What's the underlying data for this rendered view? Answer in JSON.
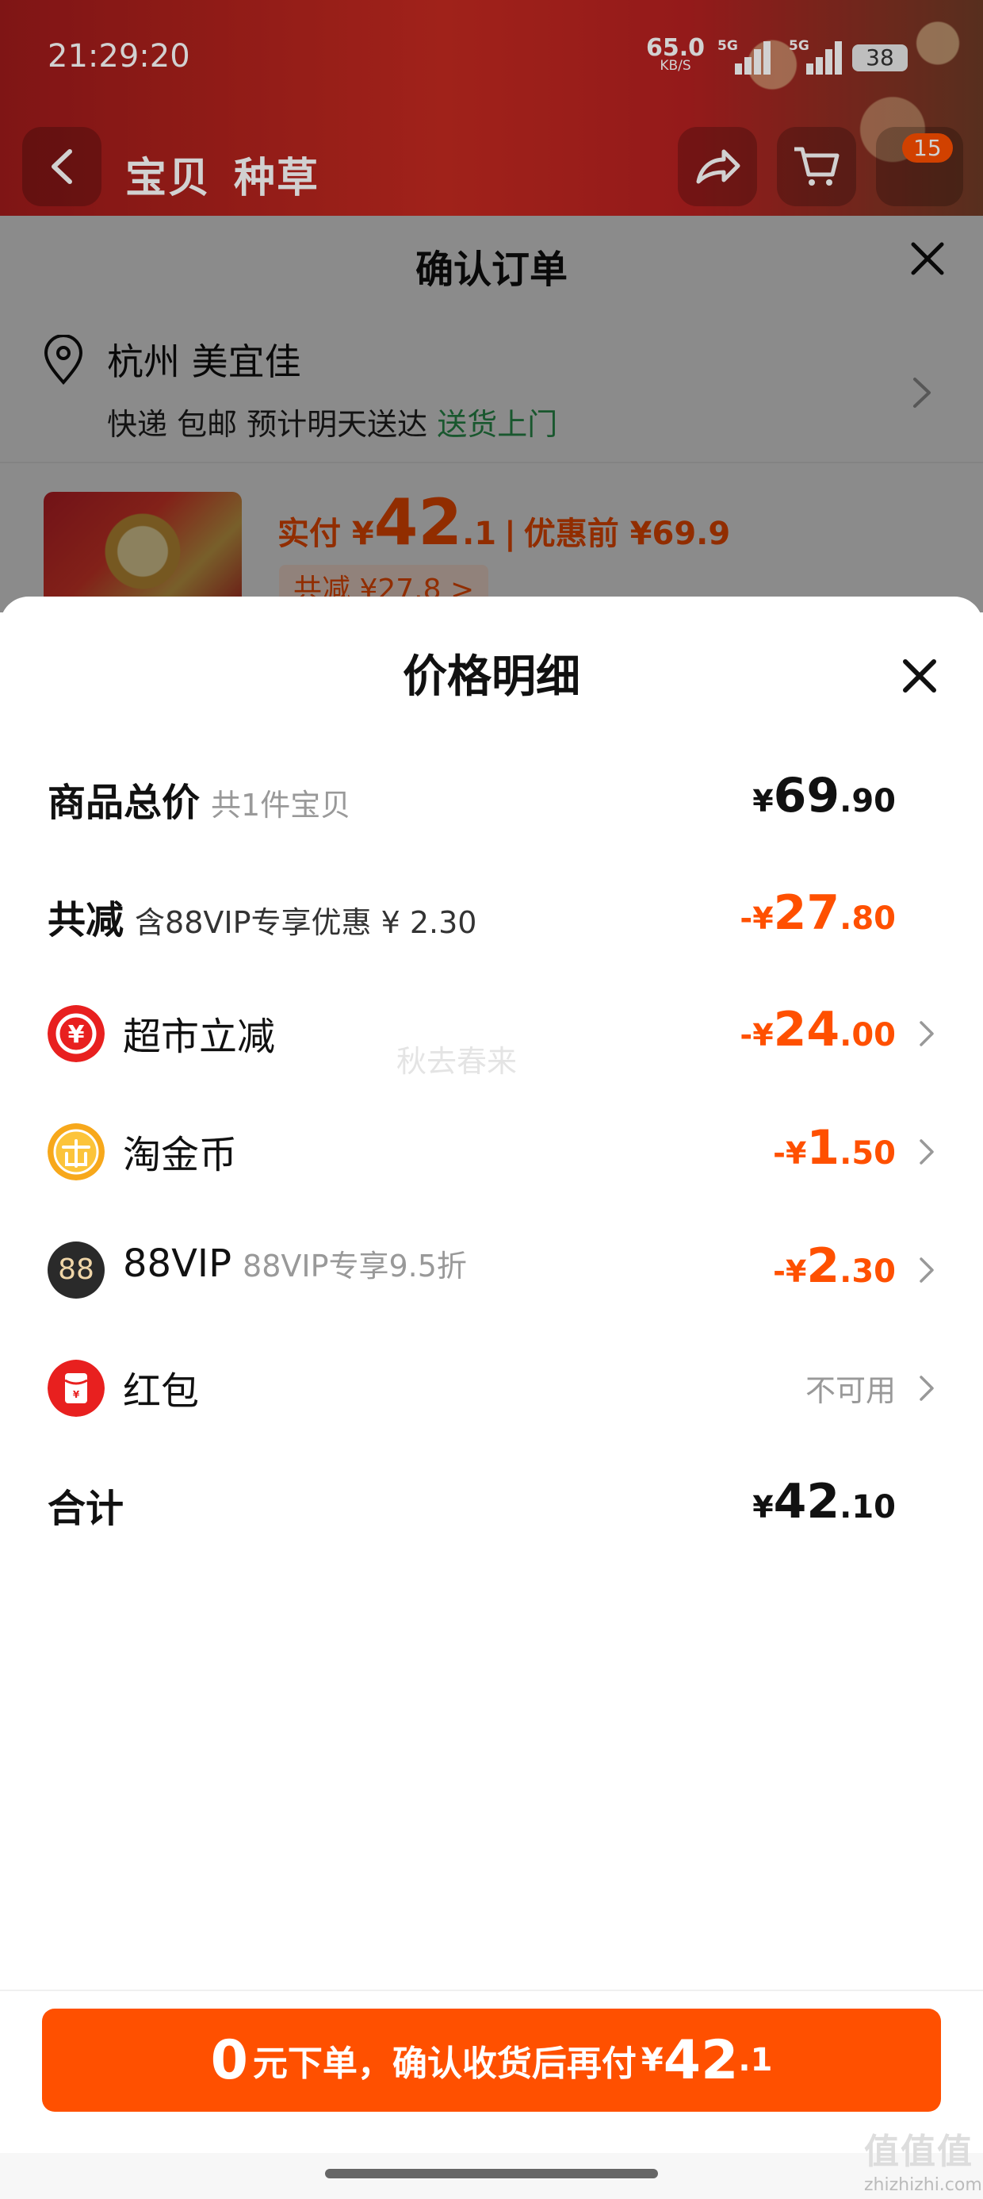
{
  "status_bar": {
    "time": "21:29:20",
    "net_speed": "65.0",
    "net_unit": "KB/S",
    "signal1_label": "5G",
    "signal2_label": "5G",
    "battery": "38"
  },
  "product_nav": {
    "tabs": [
      "宝贝",
      "种草"
    ],
    "cart_badge": "15"
  },
  "confirm_order": {
    "title": "确认订单",
    "address_name": "杭州 美宜佳",
    "delivery_text": "快递 包邮 预计明天送达",
    "delivery_link": "送货上门",
    "price_prefix": "实付 ¥",
    "price_int": "42",
    "price_dec": ".1",
    "price_before_label": "优惠前 ¥69.9",
    "saved_chip": "共减 ¥27.8 >"
  },
  "price_detail": {
    "title": "价格明细",
    "items": [
      {
        "label": "商品总价",
        "sub": "共1件宝贝",
        "currency": "¥",
        "int": "69",
        "dec": ".90"
      },
      {
        "label": "共减",
        "sub": "含88VIP专享优惠 ¥ 2.30",
        "currency": "-¥",
        "int": "27",
        "dec": ".80"
      },
      {
        "label": "超市立减",
        "icon": "supermarket-discount-icon",
        "currency": "-¥",
        "int": "24",
        "dec": ".00"
      },
      {
        "label": "淘金币",
        "icon": "taojinbi-coin-icon",
        "currency": "-¥",
        "int": "1",
        "dec": ".50"
      },
      {
        "label": "88VIP",
        "sub": "88VIP专享9.5折",
        "icon": "88vip-icon",
        "icon_text": "88",
        "currency": "-¥",
        "int": "2",
        "dec": ".30"
      },
      {
        "label": "红包",
        "icon": "red-packet-icon",
        "status": "不可用"
      },
      {
        "label": "合计",
        "currency": "¥",
        "int": "42",
        "dec": ".10"
      }
    ],
    "watermark": "秋去春来"
  },
  "pay_button": {
    "zero": "0",
    "text": "元下单，确认收货后再付",
    "currency": "¥",
    "int": "42",
    "dec": ".1"
  },
  "site_mark": {
    "logo": "值值值",
    "domain": "zhizhizhi.com"
  },
  "colors": {
    "accent": "#ff5000",
    "green_link": "#2c9a52",
    "muted": "#999999"
  }
}
